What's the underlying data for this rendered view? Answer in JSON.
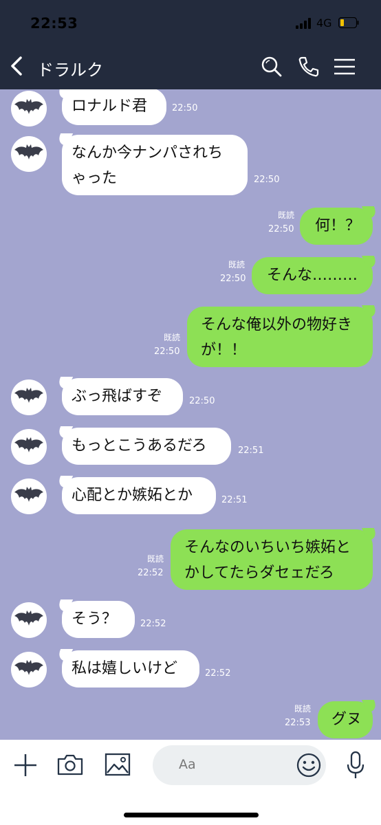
{
  "status_bar": {
    "time": "22:53",
    "network": "4G"
  },
  "header": {
    "title": "ドラルク",
    "icons": [
      "back-chevron-icon",
      "search-icon",
      "phone-icon",
      "menu-icon"
    ]
  },
  "messages": [
    {
      "side": "in",
      "text": "ロナルド君",
      "time": "22:50"
    },
    {
      "side": "in",
      "text": "なんか今ナンパされち\nゃった",
      "time": "22:50"
    },
    {
      "side": "out",
      "text": "何！？",
      "time": "22:50",
      "read": "既読"
    },
    {
      "side": "out",
      "text": "そんな………",
      "time": "22:50",
      "read": "既読"
    },
    {
      "side": "out",
      "text": "そんな俺以外の物好き\nが！！",
      "time": "22:50",
      "read": "既読"
    },
    {
      "side": "in",
      "text": "ぶっ飛ばすぞ",
      "time": "22:50"
    },
    {
      "side": "in",
      "text": "もっとこうあるだろ",
      "time": "22:51"
    },
    {
      "side": "in",
      "text": "心配とか嫉妬とか",
      "time": "22:51"
    },
    {
      "side": "out",
      "text": "そんなのいちいち嫉妬と\nかしてたらダセェだろ",
      "time": "22:52",
      "read": "既読"
    },
    {
      "side": "in",
      "text": "そう？",
      "time": "22:52"
    },
    {
      "side": "in",
      "text": "私は嬉しいけど",
      "time": "22:52"
    },
    {
      "side": "out",
      "text": "グヌ",
      "time": "22:53",
      "read": "既読"
    }
  ],
  "input": {
    "placeholder": "Aa"
  },
  "toolbar_icons": [
    "plus-icon",
    "camera-icon",
    "image-icon",
    "emoji-icon",
    "microphone-icon"
  ],
  "colors": {
    "header": "#232b3d",
    "chat_bg": "#a3a5cf",
    "outgoing": "#8de055",
    "incoming": "#ffffff"
  }
}
